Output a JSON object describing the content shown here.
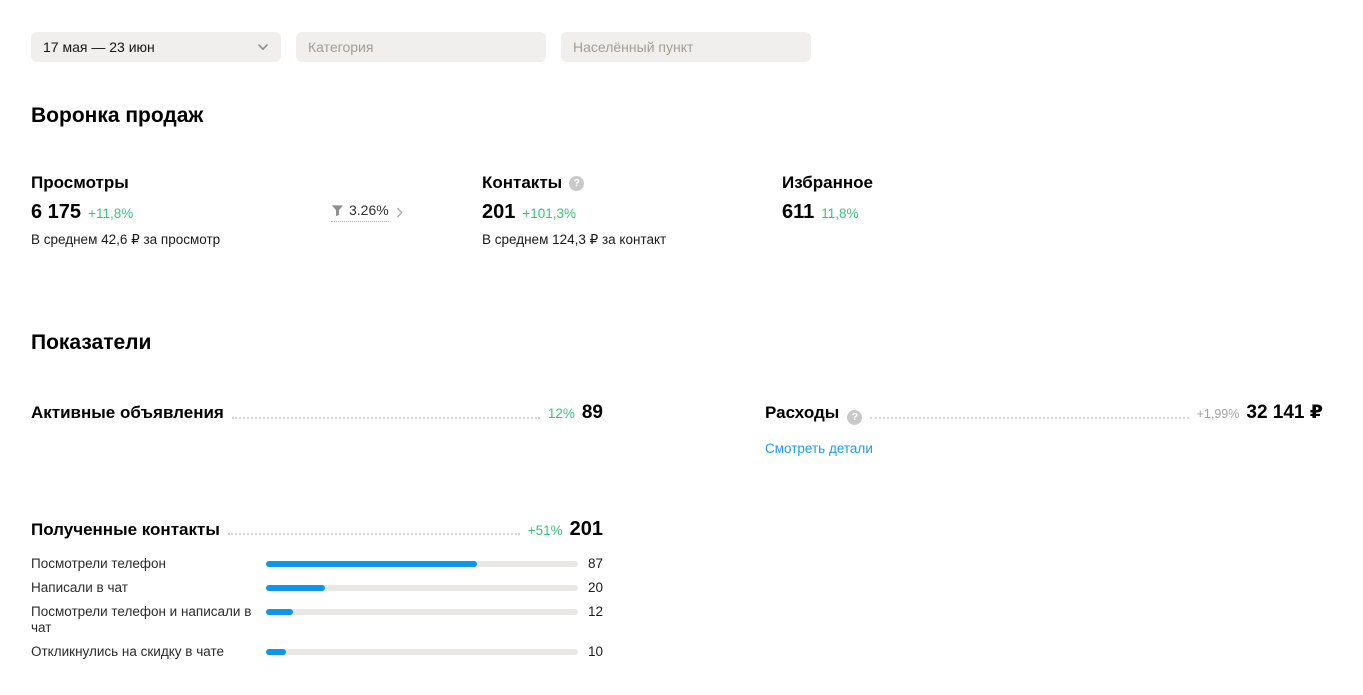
{
  "filters": {
    "date_range": {
      "value": "17 мая — 23 июн"
    },
    "category": {
      "placeholder": "Категория"
    },
    "location": {
      "placeholder": "Населённый пункт"
    }
  },
  "funnel": {
    "title": "Воронка продаж",
    "views": {
      "title": "Просмотры",
      "value": "6 175",
      "delta": "+11,8%",
      "subtitle": "В среднем 42,6 ₽ за просмотр"
    },
    "conversion": {
      "value": "3.26%"
    },
    "contacts": {
      "title": "Контакты",
      "help_glyph": "?",
      "value": "201",
      "delta": "+101,3%",
      "subtitle": "В среднем 124,3 ₽ за контакт"
    },
    "favorites": {
      "title": "Избранное",
      "value": "611",
      "delta": "11,8%"
    }
  },
  "metrics": {
    "title": "Показатели",
    "active_listings": {
      "label": "Активные объявления",
      "delta": "12%",
      "value": "89"
    },
    "expenses": {
      "label": "Расходы",
      "help_glyph": "?",
      "delta": "+1,99%",
      "value": "32 141 ₽",
      "link": "Смотреть детали"
    },
    "received_contacts": {
      "label": "Полученные контакты",
      "delta": "+51%",
      "value": "201"
    }
  },
  "chart_data": {
    "type": "bar",
    "title": "Полученные контакты",
    "total": 201,
    "categories": [
      "Посмотрели телефон",
      "Написали в чат",
      "Посмотрели телефон и написали в чат",
      "Откликнулись на скидку в чате"
    ],
    "values": [
      87,
      20,
      12,
      10
    ],
    "bar_percents": [
      67.5,
      18.8,
      8.8,
      6.5
    ],
    "xlim": [
      0,
      129
    ],
    "legend": "none",
    "grid": "off"
  },
  "colors": {
    "green": "#3bc47e",
    "delta_grey": "#a3a3a3",
    "link_blue": "#1f9bf0",
    "bar_blue": "#0d96f0",
    "bar_track": "#e8e7e5",
    "filter_bg": "#f0efed",
    "placeholder": "#a39d96",
    "leader_grey": "#d8d6d3",
    "help_icon_bg": "#c9c9c9"
  }
}
